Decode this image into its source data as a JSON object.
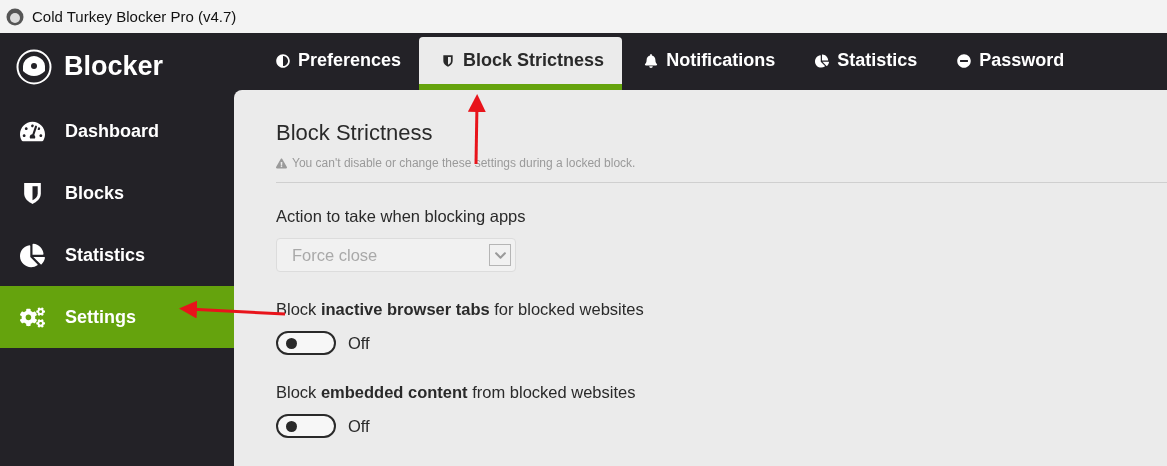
{
  "window": {
    "title": "Cold Turkey Blocker Pro (v4.7)"
  },
  "app": {
    "name": "Blocker"
  },
  "sidebar": {
    "items": [
      {
        "label": "Dashboard",
        "selected": false
      },
      {
        "label": "Blocks",
        "selected": false
      },
      {
        "label": "Statistics",
        "selected": false
      },
      {
        "label": "Settings",
        "selected": true
      }
    ]
  },
  "tabs": [
    {
      "label": "Preferences",
      "selected": false
    },
    {
      "label": "Block Strictness",
      "selected": true
    },
    {
      "label": "Notifications",
      "selected": false
    },
    {
      "label": "Statistics",
      "selected": false
    },
    {
      "label": "Password",
      "selected": false
    }
  ],
  "section": {
    "title": "Block Strictness",
    "note": "You can't disable or change these settings during a locked block."
  },
  "settings": [
    {
      "kind": "select",
      "label": "Action to take when blocking apps",
      "value": "Force close",
      "disabled": true
    },
    {
      "kind": "toggle",
      "label": "Block **inactive browser tabs** for blocked websites",
      "on": false,
      "state_text": "Off"
    },
    {
      "kind": "toggle",
      "label": "Block **embedded content** from blocked websites",
      "on": false,
      "state_text": "Off"
    }
  ]
}
